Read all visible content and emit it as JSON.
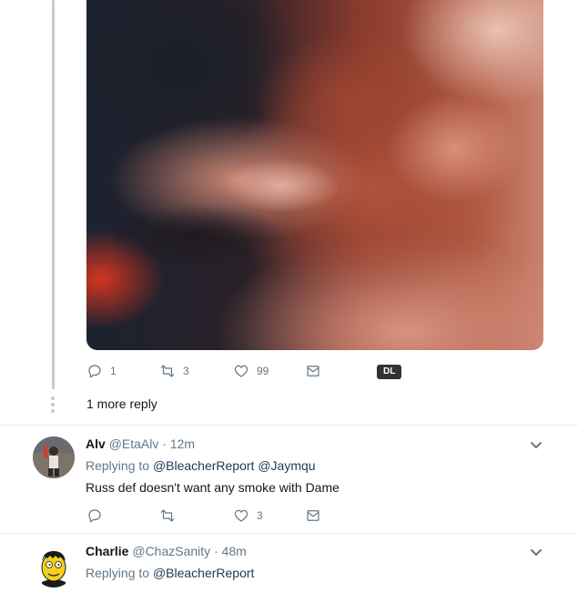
{
  "media": {
    "name": "video-thumbnail"
  },
  "main_tweet_actions": {
    "reply_count": "1",
    "retweet_count": "3",
    "like_count": "99",
    "dl_label": "DL"
  },
  "more_reply_label": "1 more reply",
  "replies": [
    {
      "name": "Alv",
      "handle": "@EtaAlv",
      "time": "· 12m",
      "replying_prefix": "Replying to",
      "mentions": "@BleacherReport @Jaymqu",
      "text": "Russ def doesn't want any smoke with Dame",
      "like_count": "3"
    },
    {
      "name": "Charlie",
      "handle": "@ChazSanity",
      "time": "· 48m",
      "replying_prefix": "Replying to",
      "mentions": "@BleacherReport"
    }
  ],
  "icons": {
    "reply": "reply-icon",
    "retweet": "retweet-icon",
    "like": "heart-icon",
    "dm": "envelope-icon",
    "more": "chevron-down-icon"
  },
  "colors": {
    "secondary_text": "#657786",
    "mention": "#1b3a57",
    "thread_line": "#c6cbd0",
    "divider": "#e6ecf0"
  }
}
